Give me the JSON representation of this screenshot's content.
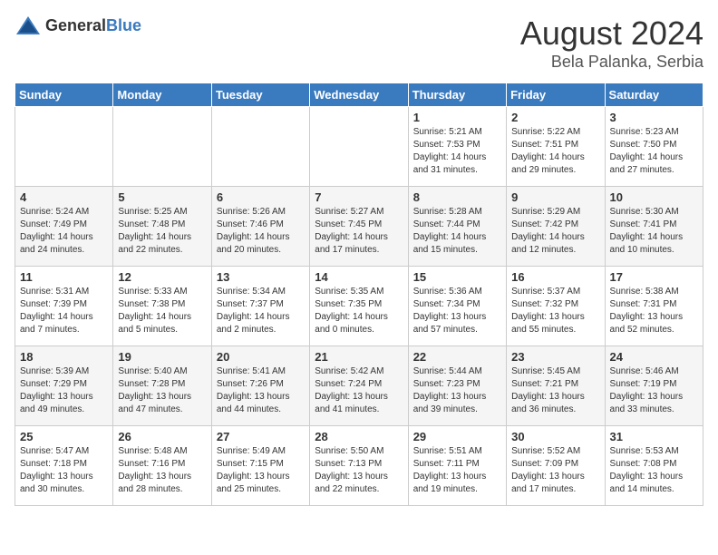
{
  "header": {
    "logo_general": "General",
    "logo_blue": "Blue",
    "month_year": "August 2024",
    "location": "Bela Palanka, Serbia"
  },
  "weekdays": [
    "Sunday",
    "Monday",
    "Tuesday",
    "Wednesday",
    "Thursday",
    "Friday",
    "Saturday"
  ],
  "weeks": [
    [
      {
        "day": "",
        "info": ""
      },
      {
        "day": "",
        "info": ""
      },
      {
        "day": "",
        "info": ""
      },
      {
        "day": "",
        "info": ""
      },
      {
        "day": "1",
        "info": "Sunrise: 5:21 AM\nSunset: 7:53 PM\nDaylight: 14 hours\nand 31 minutes."
      },
      {
        "day": "2",
        "info": "Sunrise: 5:22 AM\nSunset: 7:51 PM\nDaylight: 14 hours\nand 29 minutes."
      },
      {
        "day": "3",
        "info": "Sunrise: 5:23 AM\nSunset: 7:50 PM\nDaylight: 14 hours\nand 27 minutes."
      }
    ],
    [
      {
        "day": "4",
        "info": "Sunrise: 5:24 AM\nSunset: 7:49 PM\nDaylight: 14 hours\nand 24 minutes."
      },
      {
        "day": "5",
        "info": "Sunrise: 5:25 AM\nSunset: 7:48 PM\nDaylight: 14 hours\nand 22 minutes."
      },
      {
        "day": "6",
        "info": "Sunrise: 5:26 AM\nSunset: 7:46 PM\nDaylight: 14 hours\nand 20 minutes."
      },
      {
        "day": "7",
        "info": "Sunrise: 5:27 AM\nSunset: 7:45 PM\nDaylight: 14 hours\nand 17 minutes."
      },
      {
        "day": "8",
        "info": "Sunrise: 5:28 AM\nSunset: 7:44 PM\nDaylight: 14 hours\nand 15 minutes."
      },
      {
        "day": "9",
        "info": "Sunrise: 5:29 AM\nSunset: 7:42 PM\nDaylight: 14 hours\nand 12 minutes."
      },
      {
        "day": "10",
        "info": "Sunrise: 5:30 AM\nSunset: 7:41 PM\nDaylight: 14 hours\nand 10 minutes."
      }
    ],
    [
      {
        "day": "11",
        "info": "Sunrise: 5:31 AM\nSunset: 7:39 PM\nDaylight: 14 hours\nand 7 minutes."
      },
      {
        "day": "12",
        "info": "Sunrise: 5:33 AM\nSunset: 7:38 PM\nDaylight: 14 hours\nand 5 minutes."
      },
      {
        "day": "13",
        "info": "Sunrise: 5:34 AM\nSunset: 7:37 PM\nDaylight: 14 hours\nand 2 minutes."
      },
      {
        "day": "14",
        "info": "Sunrise: 5:35 AM\nSunset: 7:35 PM\nDaylight: 14 hours\nand 0 minutes."
      },
      {
        "day": "15",
        "info": "Sunrise: 5:36 AM\nSunset: 7:34 PM\nDaylight: 13 hours\nand 57 minutes."
      },
      {
        "day": "16",
        "info": "Sunrise: 5:37 AM\nSunset: 7:32 PM\nDaylight: 13 hours\nand 55 minutes."
      },
      {
        "day": "17",
        "info": "Sunrise: 5:38 AM\nSunset: 7:31 PM\nDaylight: 13 hours\nand 52 minutes."
      }
    ],
    [
      {
        "day": "18",
        "info": "Sunrise: 5:39 AM\nSunset: 7:29 PM\nDaylight: 13 hours\nand 49 minutes."
      },
      {
        "day": "19",
        "info": "Sunrise: 5:40 AM\nSunset: 7:28 PM\nDaylight: 13 hours\nand 47 minutes."
      },
      {
        "day": "20",
        "info": "Sunrise: 5:41 AM\nSunset: 7:26 PM\nDaylight: 13 hours\nand 44 minutes."
      },
      {
        "day": "21",
        "info": "Sunrise: 5:42 AM\nSunset: 7:24 PM\nDaylight: 13 hours\nand 41 minutes."
      },
      {
        "day": "22",
        "info": "Sunrise: 5:44 AM\nSunset: 7:23 PM\nDaylight: 13 hours\nand 39 minutes."
      },
      {
        "day": "23",
        "info": "Sunrise: 5:45 AM\nSunset: 7:21 PM\nDaylight: 13 hours\nand 36 minutes."
      },
      {
        "day": "24",
        "info": "Sunrise: 5:46 AM\nSunset: 7:19 PM\nDaylight: 13 hours\nand 33 minutes."
      }
    ],
    [
      {
        "day": "25",
        "info": "Sunrise: 5:47 AM\nSunset: 7:18 PM\nDaylight: 13 hours\nand 30 minutes."
      },
      {
        "day": "26",
        "info": "Sunrise: 5:48 AM\nSunset: 7:16 PM\nDaylight: 13 hours\nand 28 minutes."
      },
      {
        "day": "27",
        "info": "Sunrise: 5:49 AM\nSunset: 7:15 PM\nDaylight: 13 hours\nand 25 minutes."
      },
      {
        "day": "28",
        "info": "Sunrise: 5:50 AM\nSunset: 7:13 PM\nDaylight: 13 hours\nand 22 minutes."
      },
      {
        "day": "29",
        "info": "Sunrise: 5:51 AM\nSunset: 7:11 PM\nDaylight: 13 hours\nand 19 minutes."
      },
      {
        "day": "30",
        "info": "Sunrise: 5:52 AM\nSunset: 7:09 PM\nDaylight: 13 hours\nand 17 minutes."
      },
      {
        "day": "31",
        "info": "Sunrise: 5:53 AM\nSunset: 7:08 PM\nDaylight: 13 hours\nand 14 minutes."
      }
    ]
  ]
}
